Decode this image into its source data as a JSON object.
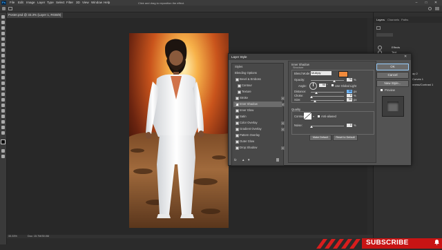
{
  "menubar": {
    "logo": "Ps",
    "items": [
      "File",
      "Edit",
      "Image",
      "Layer",
      "Type",
      "Select",
      "Filter",
      "3D",
      "View",
      "Window",
      "Help"
    ],
    "hint": "Click and drag to reposition the effect.",
    "window_controls": [
      "–",
      "□",
      "✕"
    ]
  },
  "document": {
    "tab_title": "Poster.psd @ 33.3% (Layer 1, RGB/8) *",
    "zoom": "33.33%",
    "doc_size": "Doc: 15.7M/30.0M"
  },
  "layer_style_dialog": {
    "title": "Layer Style",
    "close": "✕",
    "styles": [
      {
        "label": "Styles",
        "kind": "header"
      },
      {
        "label": "Blending Options",
        "kind": "header"
      },
      {
        "label": "Bevel & Emboss",
        "checked": false
      },
      {
        "label": "Contour",
        "checked": false,
        "indent": true
      },
      {
        "label": "Texture",
        "checked": false,
        "indent": true
      },
      {
        "label": "Stroke",
        "checked": false,
        "plus": true
      },
      {
        "label": "Inner Shadow",
        "checked": true,
        "plus": true,
        "selected": true
      },
      {
        "label": "Inner Glow",
        "checked": false
      },
      {
        "label": "Satin",
        "checked": false
      },
      {
        "label": "Color Overlay",
        "checked": false,
        "plus": true
      },
      {
        "label": "Gradient Overlay",
        "checked": false,
        "plus": true
      },
      {
        "label": "Pattern Overlay",
        "checked": false
      },
      {
        "label": "Outer Glow",
        "checked": false
      },
      {
        "label": "Drop Shadow",
        "checked": false,
        "plus": true
      }
    ],
    "footer_fx": "fx",
    "section_title": "Inner Shadow",
    "section_sub": "Structure",
    "blend_mode_label": "Blend Mode:",
    "blend_mode": "Multiply",
    "shadow_color": "#f08a3c",
    "opacity_label": "Opacity:",
    "opacity": "75",
    "opacity_unit": "%",
    "angle_label": "Angle:",
    "angle": "90",
    "angle_unit": "°",
    "global_light_label": "Use Global Light",
    "distance_label": "Distance:",
    "distance": "55",
    "distance_unit": "px",
    "choke_label": "Choke:",
    "choke": "0",
    "choke_unit": "%",
    "size_label": "Size:",
    "size": "39",
    "size_unit": "px",
    "quality_title": "Quality",
    "contour_label": "Contour:",
    "anti_aliased_label": "Anti-aliased",
    "noise_label": "Noise:",
    "noise": "0",
    "noise_unit": "%",
    "make_default": "Make Default",
    "reset_default": "Reset to Default",
    "ok": "OK",
    "cancel": "Cancel",
    "new_style": "New Style...",
    "preview_label": "Preview"
  },
  "right_dock": {
    "tabs": [
      "Layers",
      "Channels",
      "Paths"
    ],
    "layer_rows": [
      "Effects",
      "Text",
      "Stroke"
    ],
    "partial_labels": [
      "ap 2",
      "Curves 1",
      "nness/Contrast 1"
    ]
  },
  "banner": {
    "subscribe": "SUBSCRIBE"
  }
}
